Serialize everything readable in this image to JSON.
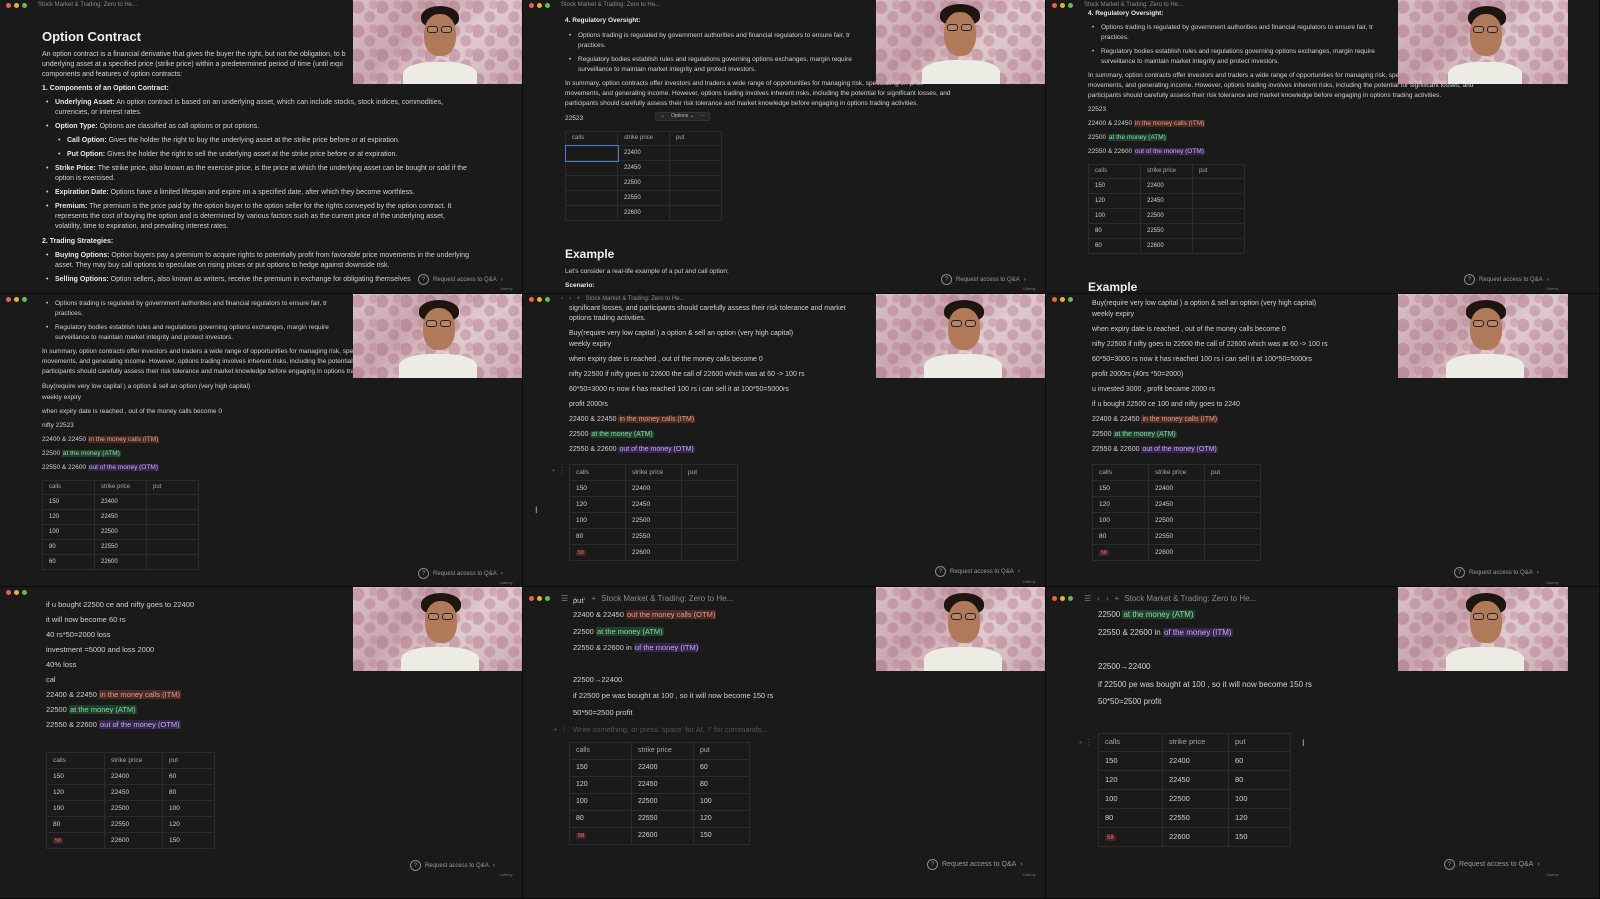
{
  "window": {
    "title": "Stock Market & Trading: Zero to He..."
  },
  "colors": {
    "background": "#1a1a1a",
    "itm": "#e99b86",
    "atm": "#8ed3a4",
    "otm": "#c8a8ef",
    "sel": "#4c7fc9"
  },
  "qa": {
    "label": "Request access to Q&A",
    "brand": "Udemy"
  },
  "toolbar": {
    "arrows": "↔",
    "options": "Options ⌄",
    "more": "···"
  },
  "placeholder": "Write something, or press 'space' for AI, '/' for commands...",
  "table_headers": [
    "calls",
    "strike price",
    "put"
  ],
  "strikes": [
    "22400",
    "22450",
    "22500",
    "22550",
    "22600"
  ],
  "calls": [
    "150",
    "120",
    "100",
    "80",
    "60"
  ],
  "calls_last_badge": "58",
  "puts": [
    "60",
    "80",
    "100",
    "120",
    "150"
  ],
  "p1": {
    "title": "Option Contract",
    "intro": [
      "An option contract is a financial derivative that gives the buyer the right, but not the obligation, to b",
      "underlying asset at a specified price (strike price) within a predetermined period of time (until expi",
      "components and features of option contracts:"
    ],
    "sec1": "1. Components of an Option Contract:",
    "ua_label": "Underlying Asset:",
    "ua_text": [
      "An option contract is based on an underlying asset, which can include stocks, stock indices, commodities,",
      "currencies, or interest rates."
    ],
    "ot_label": "Option Type:",
    "ot_text": "Options are classified as call options or put options.",
    "call_label": "Call Option:",
    "call_text": "Gives the holder the right to buy the underlying asset at the strike price before or at expiration.",
    "put_label": "Put Option:",
    "put_text": "Gives the holder the right to sell the underlying asset at the strike price before or at expiration.",
    "sp_label": "Strike Price:",
    "sp_text": [
      "The strike price, also known as the exercise price, is the price at which the underlying asset can be bought or sold if the",
      "option is exercised."
    ],
    "ed_label": "Expiration Date:",
    "ed_text": "Options have a limited lifespan and expire on a specified date, after which they become worthless.",
    "pr_label": "Premium:",
    "pr_text": [
      "The premium is the price paid by the option buyer to the option seller for the rights conveyed by the option contract. It",
      "represents the cost of buying the option and is determined by various factors such as the current price of the underlying asset,",
      "volatility, time to expiration, and prevailing interest rates."
    ],
    "sec2": "2. Trading Strategies:",
    "bo_label": "Buying Options:",
    "bo_text": [
      "Option buyers pay a premium to acquire rights to potentially profit from favorable price movements in the underlying",
      "asset. They may buy call options to speculate on rising prices or put options to hedge against downside risk."
    ],
    "so_label": "Selling Options:",
    "so_text": "Option sellers, also known as writers, receive the premium in exchange for obligating themselves"
  },
  "reg": {
    "heading": "4. Regulatory Oversight:",
    "b1": [
      "Options trading is regulated by government authorities and financial regulators to ensure fair, tr",
      "practices."
    ],
    "b2": [
      "Regulatory bodies establish rules and regulations governing options exchanges, margin require",
      "surveillance to maintain market integrity and protect investors."
    ],
    "summary": [
      "In summary, option contracts offer investors and traders a wide range of opportunities for managing risk, speculating on price",
      "movements, and generating income. However, options trading involves inherent risks, including the potential for significant losses, and",
      "participants should carefully assess their risk tolerance and market knowledge before engaging in options trading activities."
    ]
  },
  "notes": {
    "buy": "Buy(require very low capital ) a option & sell an option (very high capital)",
    "weekly": "weekly expiry",
    "expiry": "when expiry date is reached , out of the money calls become 0",
    "nifty": "nifty 22523",
    "nifty_short": "22523",
    "itm_prefix": "22400 & 22450",
    "itm_label": "in the money calls (ITM)",
    "atm_prefix": "22500",
    "atm_label": "at the money (ATM)",
    "otm_prefix": "22550 & 22600",
    "otm_label": "out of the money (OTM)",
    "scenario_1": "nifty 22500 if nifty goes to 22600 the call of 22600 which was at 60 -> 100 rs",
    "scenario_2": "60*50=3000 rs now it has reached 100 rs i can sell it at 100*50=5000rs",
    "profit": "profit 2000rs",
    "profit_long": "profit 2000rs (40rs *50=2000)",
    "invested": "u invested 3000 , profit became 2000 rs",
    "ce_buy": "if u bought 22500 ce 100 and nifty goes to 2240",
    "example": "Example",
    "example_intro": "Let's consider a real-life example of a put and call option:",
    "scenario_label": "Scenario:",
    "significant": "significant losses, and participants should carefully assess their risk tolerance and market",
    "trading_acts": "options trading activities.",
    "ce_case": "if u bought 22500 ce and nifty goes to 22400",
    "ce_60": "it will now become 60 rs",
    "loss": "40 rs*50=2000 loss",
    "investment": "investment =5000 and loss 2000",
    "pct": "40% loss",
    "cal": "cal",
    "put_word": "put",
    "itm_otm_label": "out the money calls (OTM)",
    "otm_in_label": "of the money (ITM)",
    "otm_in_prefix": "22550 & 22600 in",
    "arrow": "22500→22400",
    "pe_case": "if 22500 pe was bought at 100 , so it will now become 150 rs",
    "pe_profit": "50*50=2500 profit"
  }
}
